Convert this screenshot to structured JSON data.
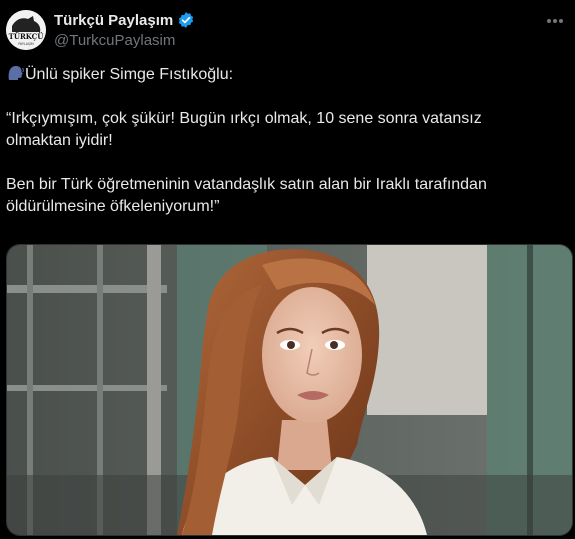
{
  "header": {
    "display_name": "Türkçü Paylaşım",
    "handle": "@TurkcuPaylasim",
    "avatar_text": "TÜRKÇÜ",
    "avatar_subtext": "PAYLAŞIM"
  },
  "tweet": {
    "line_intro": "Ünlü spiker Simge Fıstıkoğlu:",
    "paragraph_1_line_1": "“Irkçıymışım, çok şükür! Bugün ırkçı olmak, 10 sene sonra vatansız",
    "paragraph_1_line_2": "olmaktan iyidir!",
    "paragraph_2_line_1": "Ben bir Türk öğretmeninin vatandaşlık satın alan bir Iraklı tarafından",
    "paragraph_2_line_2": "öldürülmesine öfkeleniyorum!”"
  },
  "colors": {
    "background": "#000000",
    "text": "#e7e9ea",
    "secondary_text": "#71767b",
    "verified_badge": "#1d9bf0"
  },
  "icons": {
    "speaking_head": "speaking-head-icon",
    "verified": "verified-badge-icon",
    "more": "more-options-icon"
  }
}
